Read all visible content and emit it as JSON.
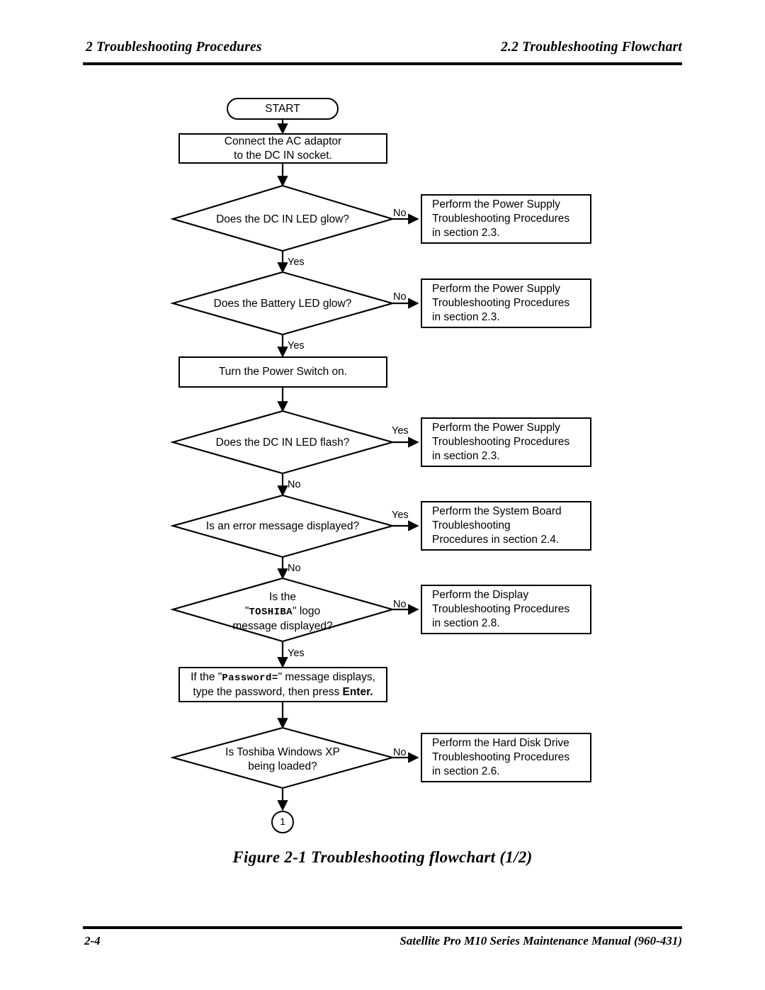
{
  "header": {
    "left": "2  Troubleshooting Procedures",
    "right": "2.2  Troubleshooting Flowchart"
  },
  "footer": {
    "page_number": "2-4",
    "manual_title": "Satellite Pro M10 Series Maintenance Manual (960-431)"
  },
  "figure": {
    "caption": "Figure 2-1  Troubleshooting flowchart (1/2)"
  },
  "flowchart": {
    "start_label": "START",
    "connector_label": "1",
    "nodes": {
      "connect_ac": {
        "line1": "Connect the AC adaptor",
        "line2": "to the DC IN socket."
      },
      "dcin_glow": {
        "text": "Does the DC IN LED glow?"
      },
      "battery_glow": {
        "text": "Does the Battery LED glow?"
      },
      "power_switch": {
        "text": "Turn the Power Switch on."
      },
      "dcin_flash": {
        "text": "Does the DC IN LED flash?"
      },
      "error_message": {
        "text": "Is an error message displayed?"
      },
      "toshiba_logo": {
        "line1": "Is the",
        "quote_open": "\"",
        "logo": "TOSHIBA",
        "quote_close": "\"",
        "line2_tail": " logo",
        "line3": "message displayed?"
      },
      "password": {
        "line1_a": "If the \"",
        "line1_mono": "Password=",
        "line1_b": "\" message displays,",
        "line2_a": "type the password, then press ",
        "line2_bold": "Enter."
      },
      "windows_xp": {
        "line1": "Is Toshiba Windows XP",
        "line2": "being loaded?"
      }
    },
    "results": {
      "power_supply_1": {
        "line1": "Perform the Power Supply",
        "line2": "Troubleshooting Procedures",
        "line3": "in section 2.3."
      },
      "power_supply_2": {
        "line1": "Perform the Power Supply",
        "line2": "Troubleshooting Procedures",
        "line3": "in section 2.3."
      },
      "power_supply_3": {
        "line1": "Perform the Power Supply",
        "line2": "Troubleshooting Procedures",
        "line3": "in section 2.3."
      },
      "system_board": {
        "line1": "Perform the System Board",
        "line2": "Troubleshooting",
        "line3": "Procedures in section 2.4."
      },
      "display": {
        "line1": "Perform the Display",
        "line2": "Troubleshooting Procedures",
        "line3": "in section 2.8."
      },
      "hard_disk": {
        "line1": "Perform the Hard Disk Drive",
        "line2": "Troubleshooting Procedures",
        "line3": "in section 2.6."
      }
    },
    "edge_labels": {
      "dcin_glow_no": "No",
      "dcin_glow_yes": "Yes",
      "battery_glow_no": "No",
      "battery_glow_yes": "Yes",
      "dcin_flash_yes": "Yes",
      "dcin_flash_no": "No",
      "error_message_yes": "Yes",
      "error_message_no": "No",
      "toshiba_logo_no": "No",
      "toshiba_logo_yes": "Yes",
      "windows_xp_no": "No"
    }
  }
}
